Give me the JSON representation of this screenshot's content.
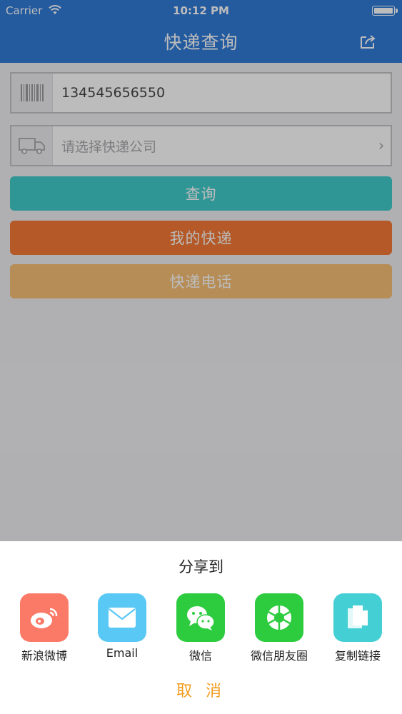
{
  "status_bar": {
    "carrier": "Carrier",
    "time": "10:12 PM"
  },
  "nav": {
    "title": "快递查询"
  },
  "tracking_input": {
    "value": "134545656550"
  },
  "company_select": {
    "placeholder": "请选择快递公司"
  },
  "buttons": {
    "query": "查询",
    "my_express": "我的快递",
    "express_phone": "快递电话"
  },
  "share_sheet": {
    "title": "分享到",
    "items": [
      {
        "label": "新浪微博",
        "icon": "weibo-icon",
        "color": "#fb7a67"
      },
      {
        "label": "Email",
        "icon": "email-icon",
        "color": "#5ac8f5"
      },
      {
        "label": "微信",
        "icon": "wechat-icon",
        "color": "#2dcc3f"
      },
      {
        "label": "微信朋友圈",
        "icon": "moments-icon",
        "color": "#2dcc3f"
      },
      {
        "label": "复制链接",
        "icon": "copy-link-icon",
        "color": "#44cfd4"
      }
    ],
    "cancel": "取 消"
  },
  "colors": {
    "nav_bg": "#0b63d1",
    "query_btn": "#1dc0c0",
    "my_express_btn": "#f25f10",
    "express_phone_btn": "#f5b45d",
    "cancel_text": "#f29b1c"
  }
}
